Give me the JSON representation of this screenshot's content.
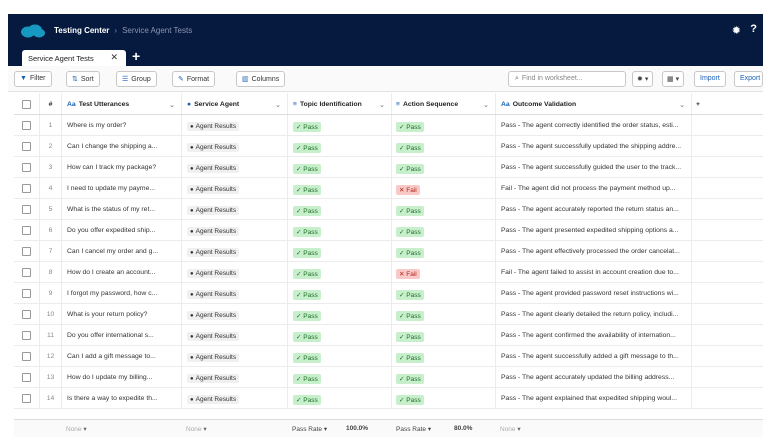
{
  "header": {
    "app_title": "Testing Center",
    "breadcrumb_current": "Service Agent Tests",
    "logo_icon": "salesforce-cloud-icon",
    "gear_icon": "gear-icon",
    "help_label": "?"
  },
  "tabs": [
    {
      "label": "Service Agent Tests",
      "close": "✕"
    }
  ],
  "tab_add": "+",
  "toolbar": {
    "filter": "Filter",
    "sort": "Sort",
    "group": "Group",
    "format": "Format",
    "columns": "Columns",
    "search_placeholder": "Find in worksheet...",
    "import": "Import",
    "export": "Export"
  },
  "columns": {
    "number": "#",
    "utterances": "Test Utterances",
    "agent": "Service Agent",
    "topic": "Topic Identification",
    "action": "Action Sequence",
    "outcome": "Outcome Validation"
  },
  "rows": [
    {
      "num": "1",
      "utterance": "Where is my order?",
      "agent": "Agent Results",
      "topic": "Pass",
      "action": "Pass",
      "outcome": "Pass - The agent correctly identified the order status, esti..."
    },
    {
      "num": "2",
      "utterance": "Can I change the shipping a...",
      "agent": "Agent Results",
      "topic": "Pass",
      "action": "Pass",
      "outcome": "Pass - The agent successfully updated the shipping addre..."
    },
    {
      "num": "3",
      "utterance": "How can I track my package?",
      "agent": "Agent Results",
      "topic": "Pass",
      "action": "Pass",
      "outcome": "Pass - The agent successfully guided the user to the track..."
    },
    {
      "num": "4",
      "utterance": "I need to update my payme...",
      "agent": "Agent Results",
      "topic": "Pass",
      "action": "Fail",
      "outcome": "Fail - The agent did not process the payment method up..."
    },
    {
      "num": "5",
      "utterance": "What is the status of my ret...",
      "agent": "Agent Results",
      "topic": "Pass",
      "action": "Pass",
      "outcome": "Pass - The agent accurately reported the return status an..."
    },
    {
      "num": "6",
      "utterance": "Do you offer expedited ship...",
      "agent": "Agent Results",
      "topic": "Pass",
      "action": "Pass",
      "outcome": "Pass - The agent presented expedited shipping options a..."
    },
    {
      "num": "7",
      "utterance": "Can I cancel my order and g...",
      "agent": "Agent Results",
      "topic": "Pass",
      "action": "Pass",
      "outcome": "Pass - The agent effectively processed the order cancelat..."
    },
    {
      "num": "8",
      "utterance": "How do I create an account...",
      "agent": "Agent Results",
      "topic": "Pass",
      "action": "Fail",
      "outcome": "Fail - The agent failed to assist in account creation due to..."
    },
    {
      "num": "9",
      "utterance": "I forgot my password, how c...",
      "agent": "Agent Results",
      "topic": "Pass",
      "action": "Pass",
      "outcome": "Pass - The agent provided password reset instructions wi..."
    },
    {
      "num": "10",
      "utterance": "What is your return policy?",
      "agent": "Agent Results",
      "topic": "Pass",
      "action": "Pass",
      "outcome": "Pass - The agent clearly detailed the return policy, includi..."
    },
    {
      "num": "11",
      "utterance": "Do you offer international s...",
      "agent": "Agent Results",
      "topic": "Pass",
      "action": "Pass",
      "outcome": "Pass - The agent confirmed the availability of internation..."
    },
    {
      "num": "12",
      "utterance": "Can I add a gift message to...",
      "agent": "Agent Results",
      "topic": "Pass",
      "action": "Pass",
      "outcome": "Pass - The agent successfully added a gift message to th..."
    },
    {
      "num": "13",
      "utterance": "How do I update my billing...",
      "agent": "Agent Results",
      "topic": "Pass",
      "action": "Pass",
      "outcome": "Pass - The agent accurately updated the billing address..."
    },
    {
      "num": "14",
      "utterance": "Is there a way to expedite th...",
      "agent": "Agent Results",
      "topic": "Pass",
      "action": "Pass",
      "outcome": "Pass - The agent explained that expedited shipping woul..."
    }
  ],
  "footer": {
    "utterances": "None",
    "agent": "None",
    "topic_label": "Pass Rate",
    "topic_value": "100.0%",
    "action_label": "Pass Rate",
    "action_value": "80.0%",
    "outcome": "None"
  },
  "colors": {
    "header_bg": "#06193f",
    "accent": "#1a5fb4",
    "pass_bg": "#c8efcb",
    "fail_bg": "#f8c9c6"
  }
}
